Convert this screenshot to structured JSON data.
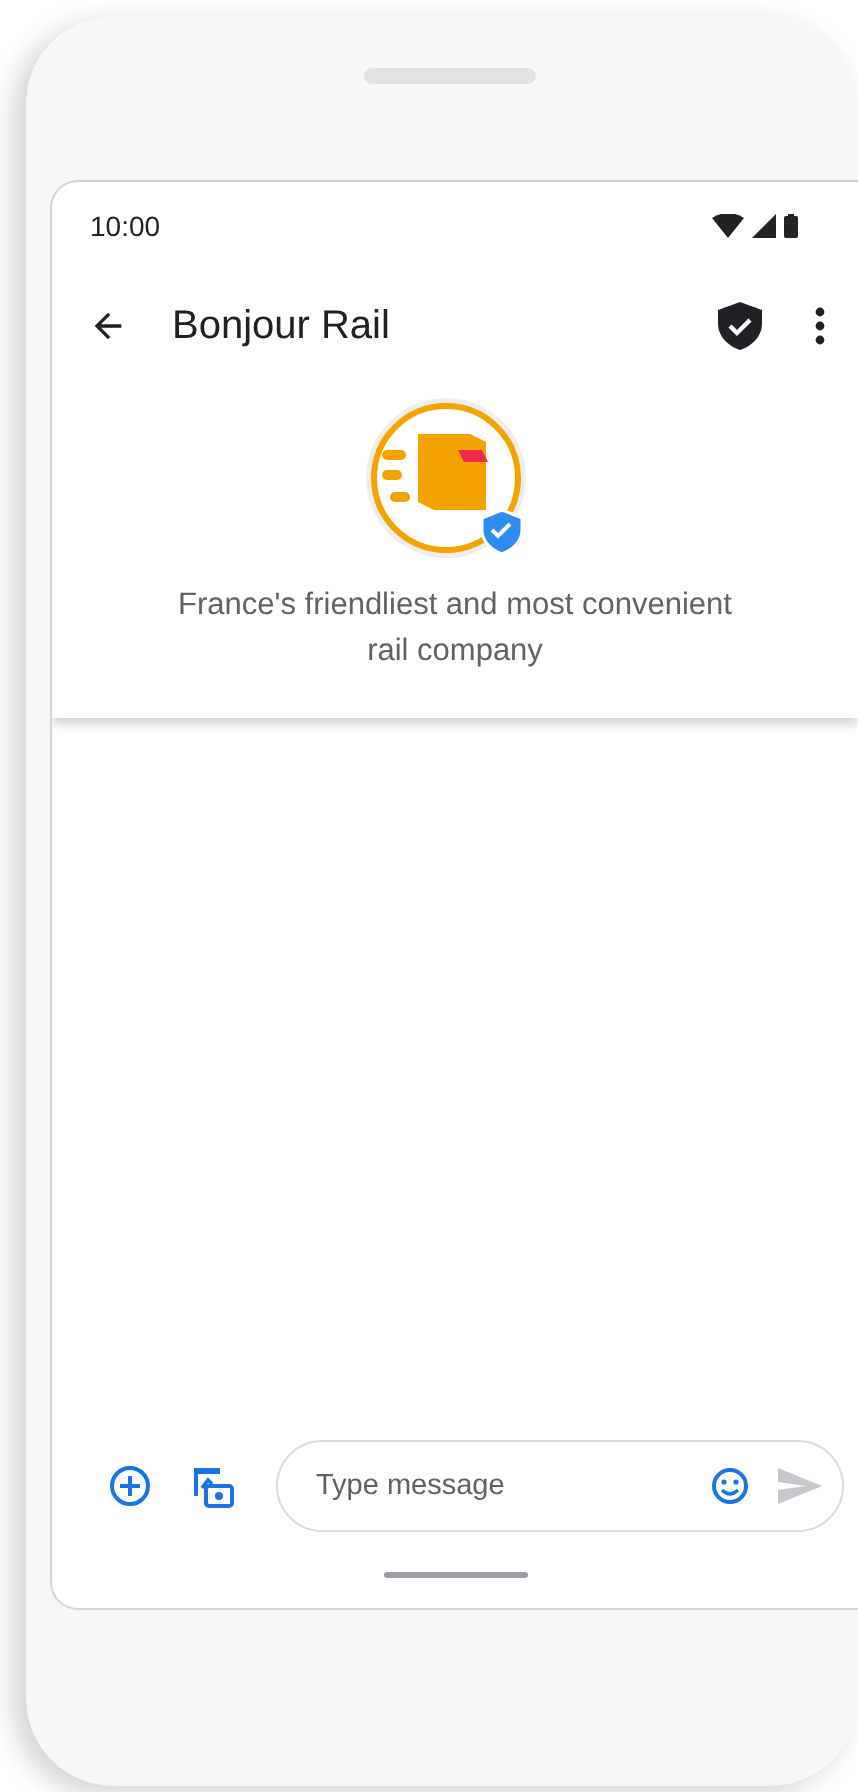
{
  "status_bar": {
    "time": "10:00"
  },
  "app_bar": {
    "title": "Bonjour Rail"
  },
  "profile": {
    "tagline": "France's friendliest and most convenient rail company"
  },
  "composer": {
    "placeholder": "Type message"
  }
}
